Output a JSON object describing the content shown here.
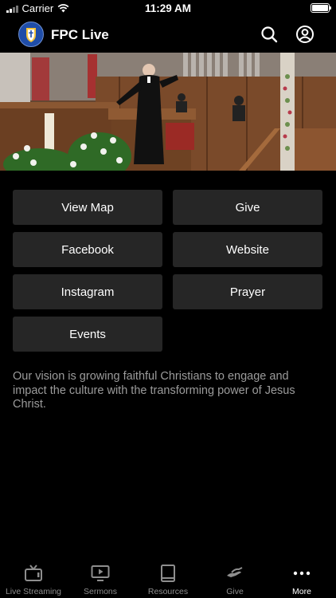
{
  "status_bar": {
    "carrier": "Carrier",
    "time": "11:29 AM"
  },
  "header": {
    "title": "FPC Live",
    "logo_icon": "church-shield-logo",
    "search_icon": "search-icon",
    "account_icon": "user-circle-icon"
  },
  "hero": {
    "description_icon": "sermon-photo"
  },
  "buttons": [
    {
      "label": "View Map"
    },
    {
      "label": "Give"
    },
    {
      "label": "Facebook"
    },
    {
      "label": "Website"
    },
    {
      "label": "Instagram"
    },
    {
      "label": "Prayer"
    },
    {
      "label": "Events"
    }
  ],
  "vision": {
    "text": "Our vision is growing faithful Christians to engage and impact the culture with the transforming power of Jesus Christ."
  },
  "tabbar": {
    "tabs": [
      {
        "label": "Live Streaming",
        "icon": "tv-icon"
      },
      {
        "label": "Sermons",
        "icon": "play-screen-icon"
      },
      {
        "label": "Resources",
        "icon": "book-icon"
      },
      {
        "label": "Give",
        "icon": "hand-give-icon"
      },
      {
        "label": "More",
        "icon": "more-dots-icon"
      }
    ],
    "active": "More"
  },
  "colors": {
    "background": "#000000",
    "button": "#262626",
    "vision_text": "#9b9b9b",
    "tab_inactive": "#8e8e8e"
  }
}
